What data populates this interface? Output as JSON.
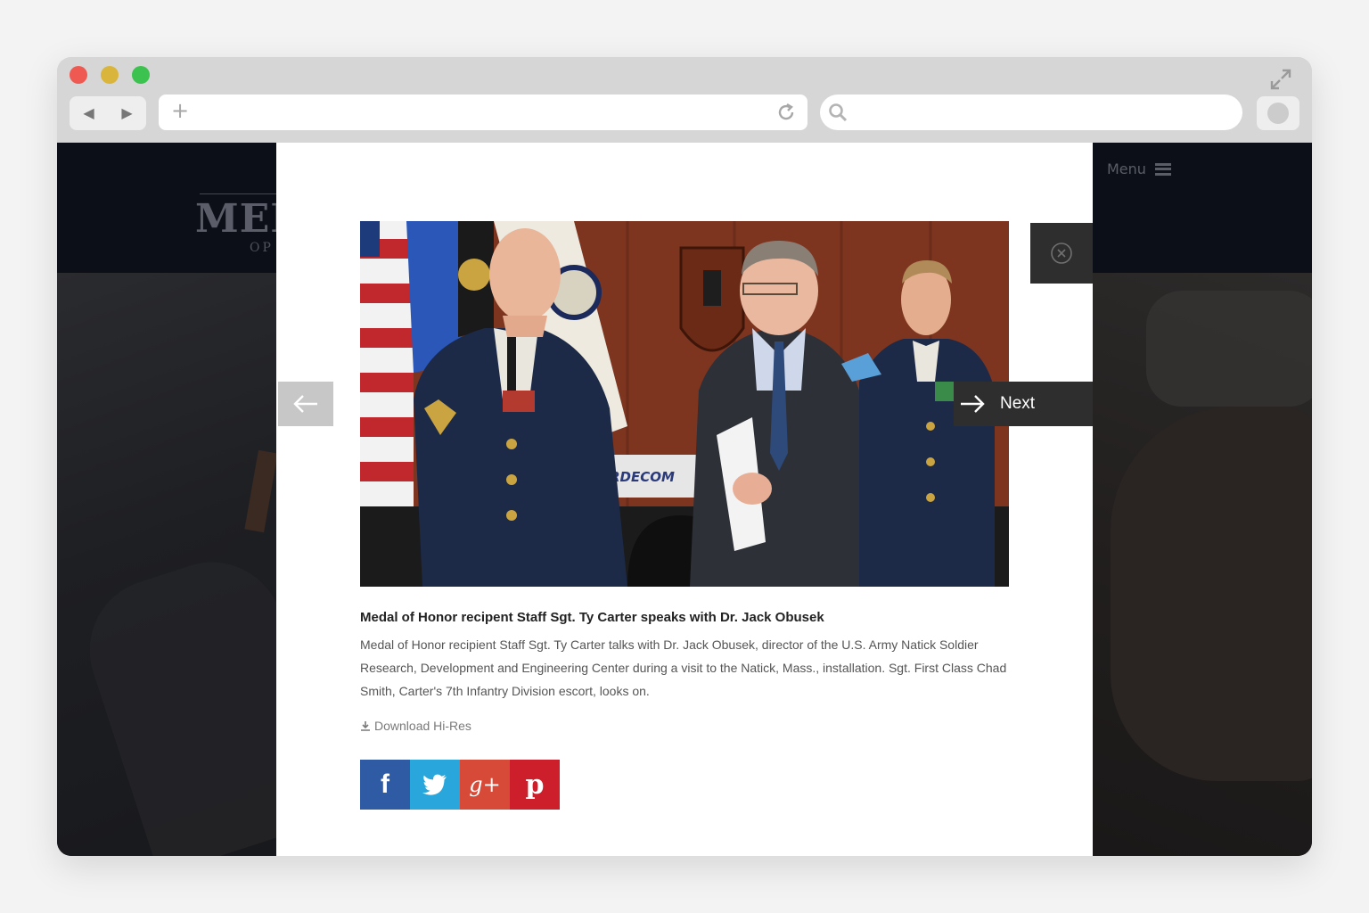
{
  "browser": {
    "nav": {
      "back": "◀",
      "forward": "▶"
    },
    "new_tab": "+"
  },
  "site": {
    "logo_text": "MEI",
    "logo_subtext": "OP",
    "menu_label": "Menu"
  },
  "lightbox": {
    "next_label": "Next",
    "caption_title": "Medal of Honor recipent Staff Sgt. Ty Carter speaks with Dr. Jack Obusek",
    "caption_body": "Medal of Honor recipient Staff Sgt. Ty Carter talks with Dr. Jack Obusek, director of the U.S. Army Natick Soldier Research, Development and Engineering Center during a visit to the Natick, Mass., installation. Sgt. First Class Chad Smith, Carter's 7th Infantry Division escort, looks on.",
    "download_label": "Download Hi-Res",
    "photo_sign_text": "RDECOM",
    "share": {
      "facebook": "f",
      "google_plus": "g+",
      "pinterest": "p"
    }
  },
  "colors": {
    "facebook": "#2f5aa4",
    "twitter": "#29a7dc",
    "google_plus": "#d74a38",
    "pinterest": "#cc1f2b",
    "overlay_button": "#2e2e2e"
  },
  "icons": [
    "back-icon",
    "forward-icon",
    "plus-icon",
    "reload-icon",
    "search-icon",
    "expand-icon",
    "close-icon",
    "arrow-left-icon",
    "arrow-right-icon",
    "download-icon",
    "facebook-icon",
    "twitter-icon",
    "google-plus-icon",
    "pinterest-icon",
    "hamburger-icon"
  ]
}
